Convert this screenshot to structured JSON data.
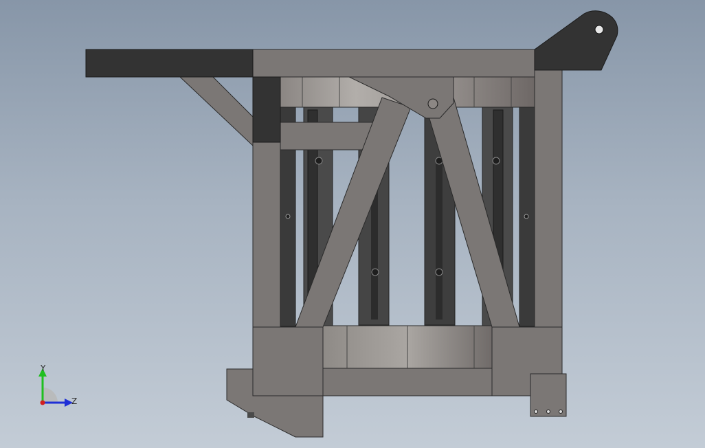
{
  "viewport": {
    "background_top": "#8796a8",
    "background_bottom": "#c3ccd6"
  },
  "model": {
    "frame_color": "#7b7775",
    "dark_color": "#333333",
    "edge_color": "#2a2a2a",
    "slot_color": "#3c3c3c"
  },
  "triad": {
    "y_label": "Y",
    "z_label": "Z",
    "y_color": "#1fbf1f",
    "z_color": "#1e2fd6",
    "x_color": "#d21f1f"
  }
}
